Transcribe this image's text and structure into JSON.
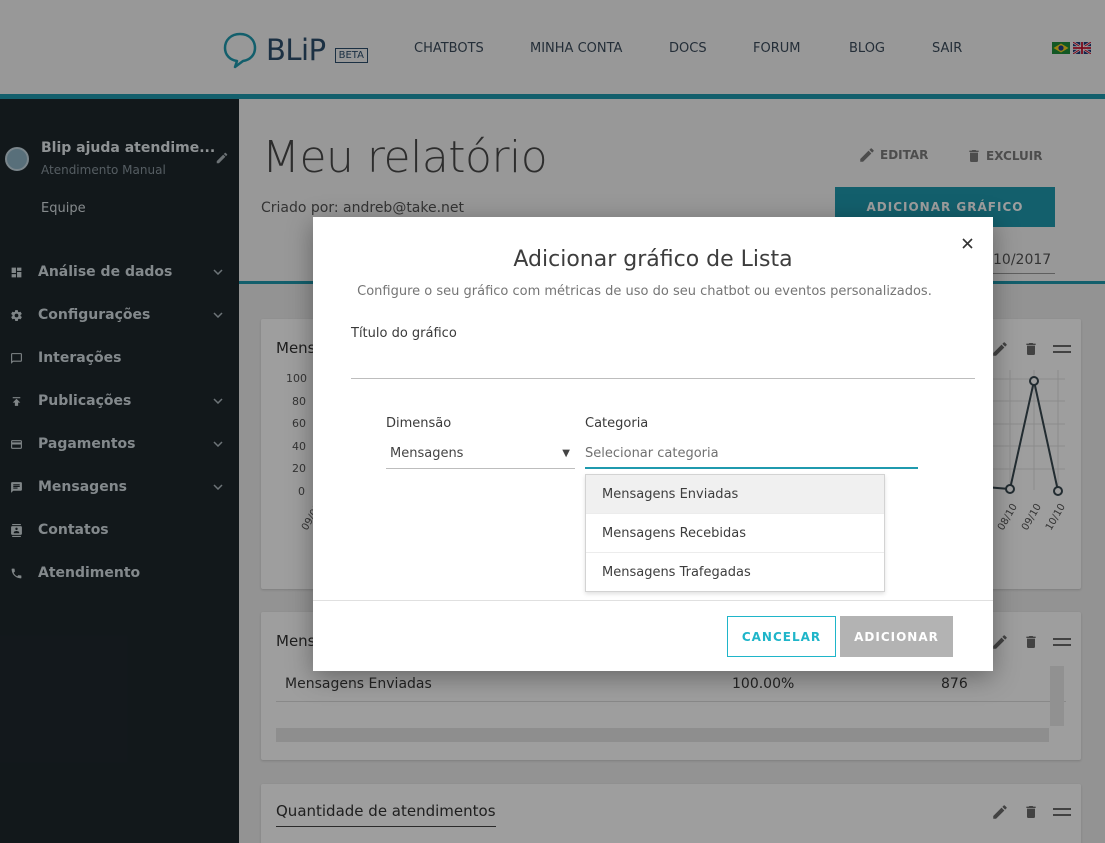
{
  "header": {
    "logo_text": "BLiP",
    "beta": "BETA",
    "nav": [
      "CHATBOTS",
      "MINHA CONTA",
      "DOCS",
      "FORUM",
      "BLOG",
      "SAIR"
    ]
  },
  "sidebar": {
    "bot_name": "Blip ajuda atendime...",
    "bot_subtitle": "Atendimento Manual",
    "team": "Equipe",
    "items": [
      {
        "label": "Análise de dados",
        "icon": "dashboard-icon"
      },
      {
        "label": "Configurações",
        "icon": "gear-icon"
      },
      {
        "label": "Interações",
        "icon": "chat-bubble-icon"
      },
      {
        "label": "Publicações",
        "icon": "upload-icon"
      },
      {
        "label": "Pagamentos",
        "icon": "credit-card-icon"
      },
      {
        "label": "Mensagens",
        "icon": "message-icon"
      },
      {
        "label": "Contatos",
        "icon": "contacts-icon"
      },
      {
        "label": "Atendimento",
        "icon": "phone-icon"
      }
    ]
  },
  "page": {
    "title": "Meu relatório",
    "created_by": "Criado por: andreb@take.net",
    "edit_label": "EDITAR",
    "delete_label": "EXCLUIR",
    "add_chart_label": "ADICIONAR GRÁFICO",
    "date_value": "10/2017"
  },
  "cards": {
    "chart1_title": "Mens",
    "chart1_yticks": [
      "100",
      "80",
      "60",
      "40",
      "20",
      "0"
    ],
    "chart1_xticks_left": "09/09",
    "chart1_xticks_right": [
      "08/10",
      "09/10",
      "10/10"
    ],
    "table_title": "Mens",
    "table_row": {
      "name": "Mensagens Enviadas",
      "percent": "100.00%",
      "count": "876"
    },
    "card3_title": "Quantidade de atendimentos"
  },
  "modal": {
    "title": "Adicionar gráfico de Lista",
    "subtitle": "Configure o seu gráfico com métricas de uso do seu chatbot ou eventos personalizados.",
    "chart_title_label": "Título do gráfico",
    "chart_title_value": "",
    "dimension_label": "Dimensão",
    "dimension_value": "Mensagens",
    "category_label": "Categoria",
    "category_placeholder": "Selecionar categoria",
    "category_options": [
      "Mensagens Enviadas",
      "Mensagens Recebidas",
      "Mensagens Trafegadas"
    ],
    "cancel_label": "CANCELAR",
    "add_label": "ADICIONAR"
  },
  "colors": {
    "accent": "#1f9aae",
    "sidebar_bg": "#1e272d",
    "button_disabled": "#b3b3b3",
    "cancel_text": "#1fb5c9"
  }
}
